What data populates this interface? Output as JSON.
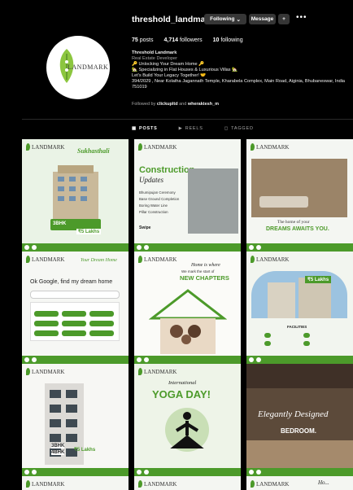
{
  "profile": {
    "username": "threshold_landmark",
    "avatar_brand": "LANDMARK",
    "following_label": "Following",
    "message_label": "Message",
    "posts_count": "75",
    "posts_label": "posts",
    "followers_count": "4,714",
    "followers_label": "followers",
    "following_count": "10",
    "following_count_label": "following",
    "full_name": "Threshold Landmark",
    "category": "Real Estate Developer",
    "bio_lines": [
      "🔑 Unlocking Your Dream Home 🔑",
      "🏡 Specializing in Flat Houses & Luxurious Villas 🏡",
      "Let's Build Your Legacy Together! 🤝",
      "394/2029 , Near Kolatha Jagannath Temple, Kharabela Complex, Main Road, Aiginia, Bhubaneswar, India 751019"
    ],
    "followed_by_prefix": "Followed by",
    "followed_by_1": "clickupltd",
    "followed_by_and": "and",
    "followed_by_2": "wheraktesh_m"
  },
  "tabs": [
    {
      "label": "POSTS",
      "icon": "grid-icon",
      "active": true
    },
    {
      "label": "REELS",
      "icon": "reels-icon",
      "active": false
    },
    {
      "label": "TAGGED",
      "icon": "tag-icon",
      "active": false
    }
  ],
  "posts": {
    "brand": "LANDMARK",
    "p1": {
      "headline": "Sukhasthali",
      "price": "₹5 Lakhs",
      "bhk": "3BHK"
    },
    "p2": {
      "title_1": "Construction",
      "title_2": "Updates",
      "items": [
        "Bhumipujan Ceremony",
        "Base Ground Completion",
        "Boring Water Line",
        "Pillar Construction"
      ],
      "cta": "Swipe"
    },
    "p3": {
      "caption_1": "The home of your",
      "caption_2": "DREAMS AWAITS YOU."
    },
    "p4": {
      "script": "Your Dream Home",
      "search_text": "Ok Google, find my dream home"
    },
    "p5": {
      "line_1": "Home is where",
      "line_2": "We mark the start of",
      "line_3": "NEW CHAPTERS"
    },
    "p6": {
      "price": "₹5 Lakhs",
      "facilities": "FACILITIES"
    },
    "p7": {
      "bhk_1": "3BHK",
      "bhk_2": "4BHK",
      "price": "₹5 Lakhs"
    },
    "p8": {
      "script": "International",
      "title": "YOGA DAY!"
    },
    "p9": {
      "script": "Elegantly Designed",
      "title": "BEDROOM."
    },
    "p12": {
      "script": "Ho..."
    }
  },
  "colors": {
    "accent": "#4c9a2a",
    "bg": "#000000",
    "button": "#363636"
  }
}
